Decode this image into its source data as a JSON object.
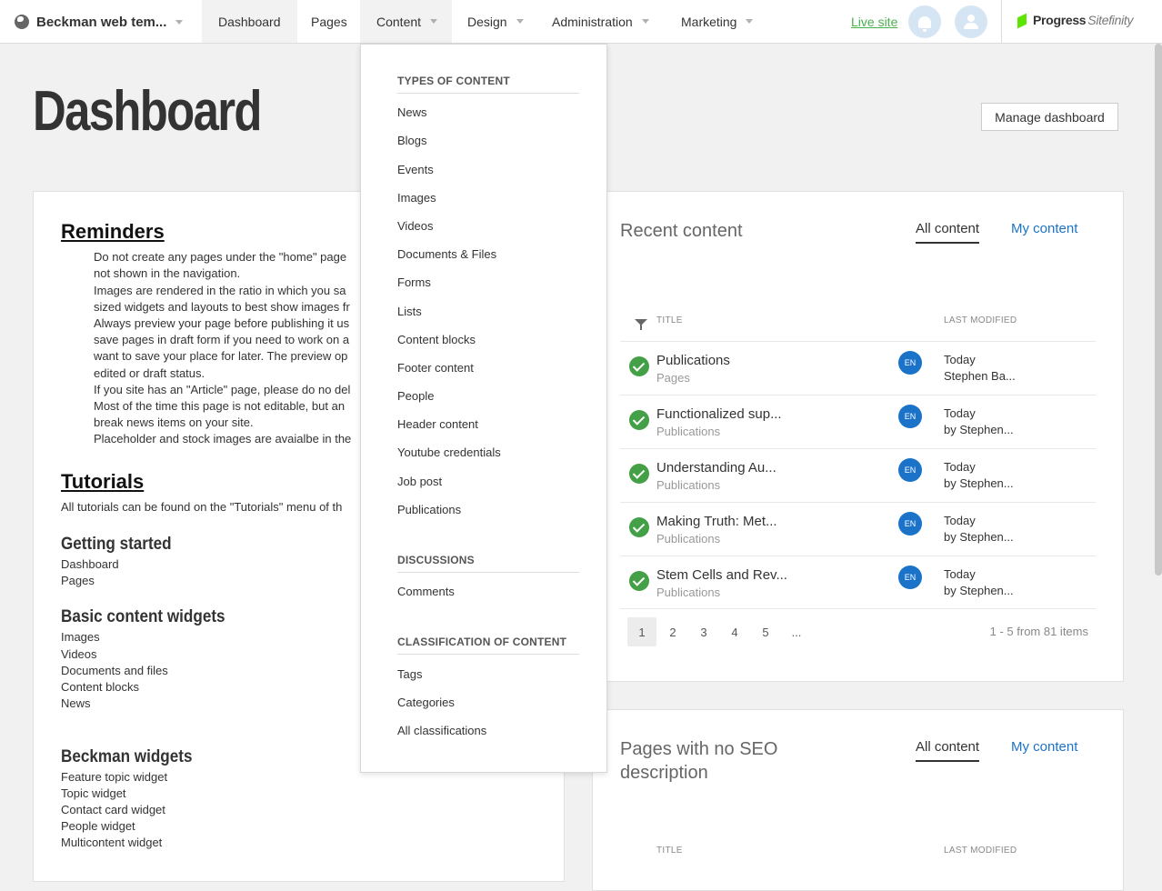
{
  "topbar": {
    "site_name": "Beckman web tem...",
    "nav": [
      "Dashboard",
      "Pages",
      "Content",
      "Design",
      "Administration",
      "Marketing"
    ],
    "live_site": "Live site",
    "brand_name": "Progress",
    "brand_product": "Sitefinity"
  },
  "page": {
    "title": "Dashboard",
    "manage_button": "Manage dashboard"
  },
  "left": {
    "reminders_heading": "Reminders",
    "reminders": [
      "Do not create any pages under the \"home\" page",
      "not shown in the navigation.",
      "Images are rendered in the ratio in which you sa",
      "sized widgets and layouts to best show images fr",
      "Always preview your page before publishing it us",
      "save pages in draft form if you need to work on a",
      "want to save your place for later. The preview op",
      "edited or draft status.",
      "If you site has an \"Article\" page, please do no del",
      "Most of the time this page is not editable, but an",
      "break news items on your site.",
      "Placeholder and stock images are avaialbe in the"
    ],
    "tutorials_heading": "Tutorials",
    "tutorials_intro": "All tutorials can be found on the \"Tutorials\" menu of th",
    "getting_started": {
      "heading": "Getting started",
      "items": [
        "Dashboard",
        "Pages"
      ]
    },
    "basic_widgets": {
      "heading": "Basic content widgets",
      "items": [
        "Images",
        "Videos",
        "Documents and files",
        "Content blocks",
        "News"
      ]
    },
    "beckman_widgets": {
      "heading": "Beckman widgets",
      "items": [
        "Feature topic widget",
        "Topic widget",
        "Contact card widget",
        "People widget",
        "Multicontent widget"
      ]
    }
  },
  "recent": {
    "title": "Recent content",
    "tab_all": "All content",
    "tab_my": "My content",
    "col_title": "TITLE",
    "col_modified": "LAST MODIFIED",
    "rows": [
      {
        "title": "Publications",
        "type": "Pages",
        "lang": "EN",
        "date": "Today",
        "by": "Stephen Ba..."
      },
      {
        "title": "Functionalized sup...",
        "type": "Publications",
        "lang": "EN",
        "date": "Today",
        "by": "by Stephen..."
      },
      {
        "title": "Understanding Au...",
        "type": "Publications",
        "lang": "EN",
        "date": "Today",
        "by": "by Stephen..."
      },
      {
        "title": "Making Truth: Met...",
        "type": "Publications",
        "lang": "EN",
        "date": "Today",
        "by": "by Stephen..."
      },
      {
        "title": "Stem Cells and Rev...",
        "type": "Publications",
        "lang": "EN",
        "date": "Today",
        "by": "by Stephen..."
      }
    ],
    "pages": [
      "1",
      "2",
      "3",
      "4",
      "5",
      "..."
    ],
    "page_info": "1 - 5 from 81 items"
  },
  "seo": {
    "title_line1": "Pages with no SEO",
    "title_line2": "description",
    "tab_all": "All content",
    "tab_my": "My content",
    "col_title": "TITLE",
    "col_modified": "LAST MODIFIED"
  },
  "dropdown": {
    "types_heading": "TYPES OF CONTENT",
    "types": [
      "News",
      "Blogs",
      "Events",
      "Images",
      "Videos",
      "Documents & Files",
      "Forms",
      "Lists",
      "Content blocks",
      "Footer content",
      "People",
      "Header content",
      "Youtube credentials",
      "Job post",
      "Publications"
    ],
    "discussions_heading": "DISCUSSIONS",
    "discussions": [
      "Comments"
    ],
    "classification_heading": "CLASSIFICATION OF CONTENT",
    "classification": [
      "Tags",
      "Categories",
      "All classifications"
    ]
  },
  "colors": {
    "accent_blue": "#1a73c9",
    "success_green": "#43a047",
    "live_site_green": "#4caf50",
    "brand_green": "#5ce500"
  }
}
